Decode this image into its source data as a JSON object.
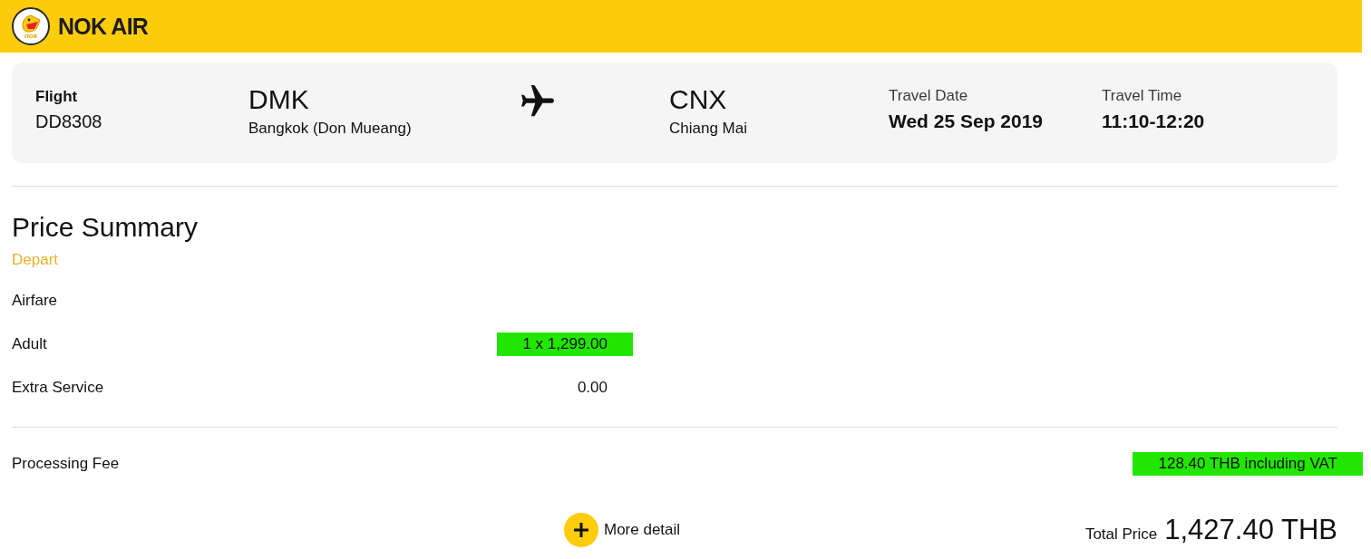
{
  "header": {
    "logo_text": "nok",
    "brand": "NOK AIR"
  },
  "flight_card": {
    "flight": {
      "label": "Flight",
      "value": "DD8308"
    },
    "origin": {
      "code": "DMK",
      "city": "Bangkok (Don Mueang)"
    },
    "destination": {
      "code": "CNX",
      "city": "Chiang Mai"
    },
    "travel_date": {
      "label": "Travel Date",
      "value": "Wed 25 Sep 2019"
    },
    "travel_time": {
      "label": "Travel Time",
      "value": "11:10-12:20"
    }
  },
  "price_summary": {
    "title": "Price Summary",
    "section": "Depart",
    "rows": [
      {
        "label": "Airfare"
      },
      {
        "label": "Adult",
        "value": "1 x 1,299.00",
        "highlighted": true
      },
      {
        "label": "Extra Service",
        "value": "0.00",
        "highlighted": false
      }
    ]
  },
  "processing_fee": {
    "label": "Processing Fee",
    "value": "128.40 THB including VAT",
    "highlighted": true
  },
  "footer": {
    "more_detail": {
      "label": "More detail"
    },
    "total": {
      "label": "Total Price",
      "value": "1,427.40 THB"
    }
  }
}
